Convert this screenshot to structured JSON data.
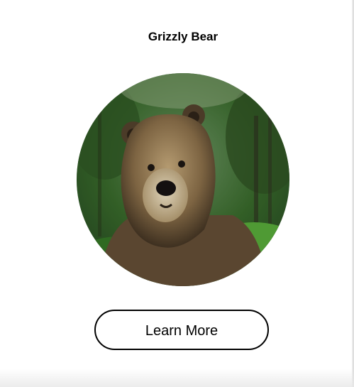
{
  "card": {
    "title": "Grizzly Bear",
    "image_subject": "grizzly-bear-photo",
    "button_label": "Learn More"
  },
  "colors": {
    "background": "#ffffff",
    "text": "#000000",
    "button_border": "#000000",
    "foliage_dark": "#1f3d1a",
    "foliage_light": "#5a8f3a",
    "fur": "#8a7048"
  }
}
